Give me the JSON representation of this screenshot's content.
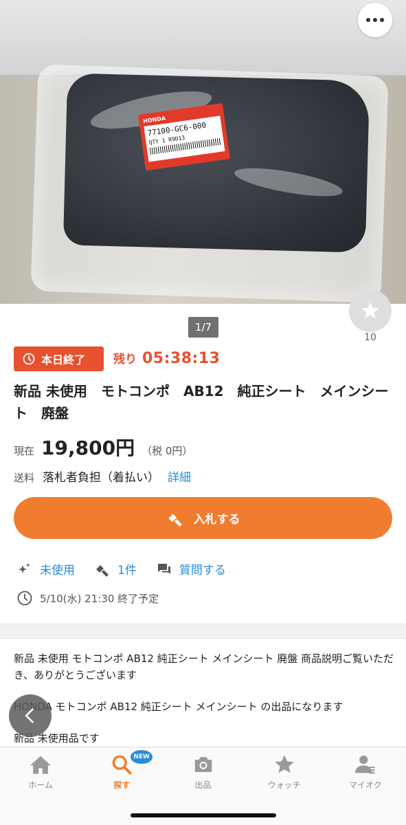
{
  "photo": {
    "label_brand": "HONDA",
    "label_part": "77100-GC6-000",
    "label_qty": "QTY 1    R9D13",
    "counter": "1/7"
  },
  "watch": {
    "count": "10"
  },
  "auction": {
    "ending_badge": "本日終了",
    "remaining_label": "残り",
    "remaining_time": "05:38:13",
    "title": "新品 未使用　モトコンポ　AB12　純正シート　メインシート　廃盤",
    "price_label": "現在",
    "price": "19,800円",
    "tax": "（税 0円）",
    "shipping_label": "送料",
    "shipping_value": "落札者負担（着払い）",
    "shipping_link": "詳細",
    "bid_button": "入札する",
    "condition": "未使用",
    "bid_count": "1件",
    "question": "質問する",
    "end_time": "5/10(水) 21:30 終了予定"
  },
  "description": {
    "line1": "新品 未使用 モトコンポ AB12 純正シート メインシート 廃盤 商品説明ご覧いただき、ありがとうございます",
    "line2": "HONDA モトコンポ AB12 純正シート メインシート の出品になります",
    "line3": "新品 未使用品です"
  },
  "tabbar": {
    "home": "ホーム",
    "search": "探す",
    "new_badge": "NEW",
    "sell": "出品",
    "watch": "ウォッチ",
    "mypage": "マイオク"
  },
  "colors": {
    "accent": "#f07c2f",
    "alert": "#e8502f",
    "link": "#2a8bd6"
  }
}
